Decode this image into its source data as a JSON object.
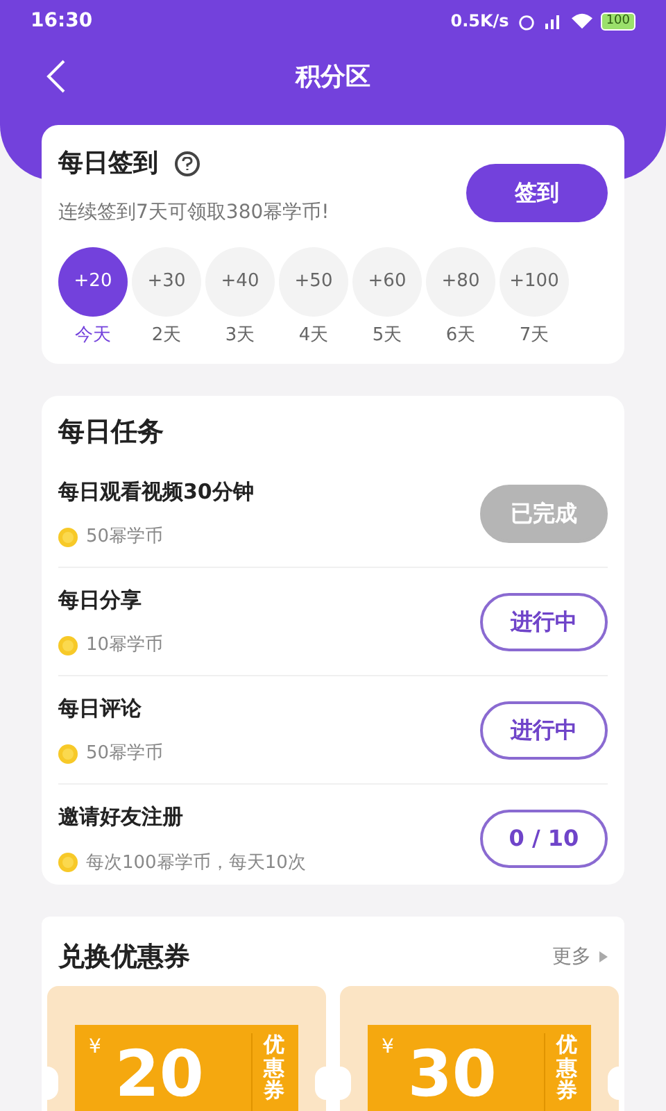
{
  "status_bar": {
    "time": "16:30",
    "speed": "0.5K/s",
    "battery": "100"
  },
  "header": {
    "title": "积分区"
  },
  "checkin": {
    "title": "每日签到",
    "subtitle": "连续签到7天可领取380幂学币!",
    "button": "签到",
    "days": [
      {
        "points": "+20",
        "label": "今天",
        "selected": true
      },
      {
        "points": "+30",
        "label": "2天",
        "selected": false
      },
      {
        "points": "+40",
        "label": "3天",
        "selected": false
      },
      {
        "points": "+50",
        "label": "4天",
        "selected": false
      },
      {
        "points": "+60",
        "label": "5天",
        "selected": false
      },
      {
        "points": "+80",
        "label": "6天",
        "selected": false
      },
      {
        "points": "+100",
        "label": "7天",
        "selected": false
      }
    ]
  },
  "tasks": {
    "title": "每日任务",
    "items": [
      {
        "name": "每日观看视频30分钟",
        "reward": "50幂学币",
        "kind": "done",
        "button": "已完成"
      },
      {
        "name": "每日分享",
        "reward": "10幂学币",
        "kind": "progress",
        "button": "进行中"
      },
      {
        "name": "每日评论",
        "reward": "50幂学币",
        "kind": "progress",
        "button": "进行中"
      },
      {
        "name": "邀请好友注册",
        "reward": "每次100幂学币，每天10次",
        "kind": "progress",
        "button": "0 / 10"
      }
    ]
  },
  "coupons": {
    "title": "兑换优惠券",
    "more": "更多",
    "items": [
      {
        "currency": "¥",
        "amount": "20",
        "label": "优惠券"
      },
      {
        "currency": "¥",
        "amount": "30",
        "label": "优惠券"
      }
    ]
  }
}
